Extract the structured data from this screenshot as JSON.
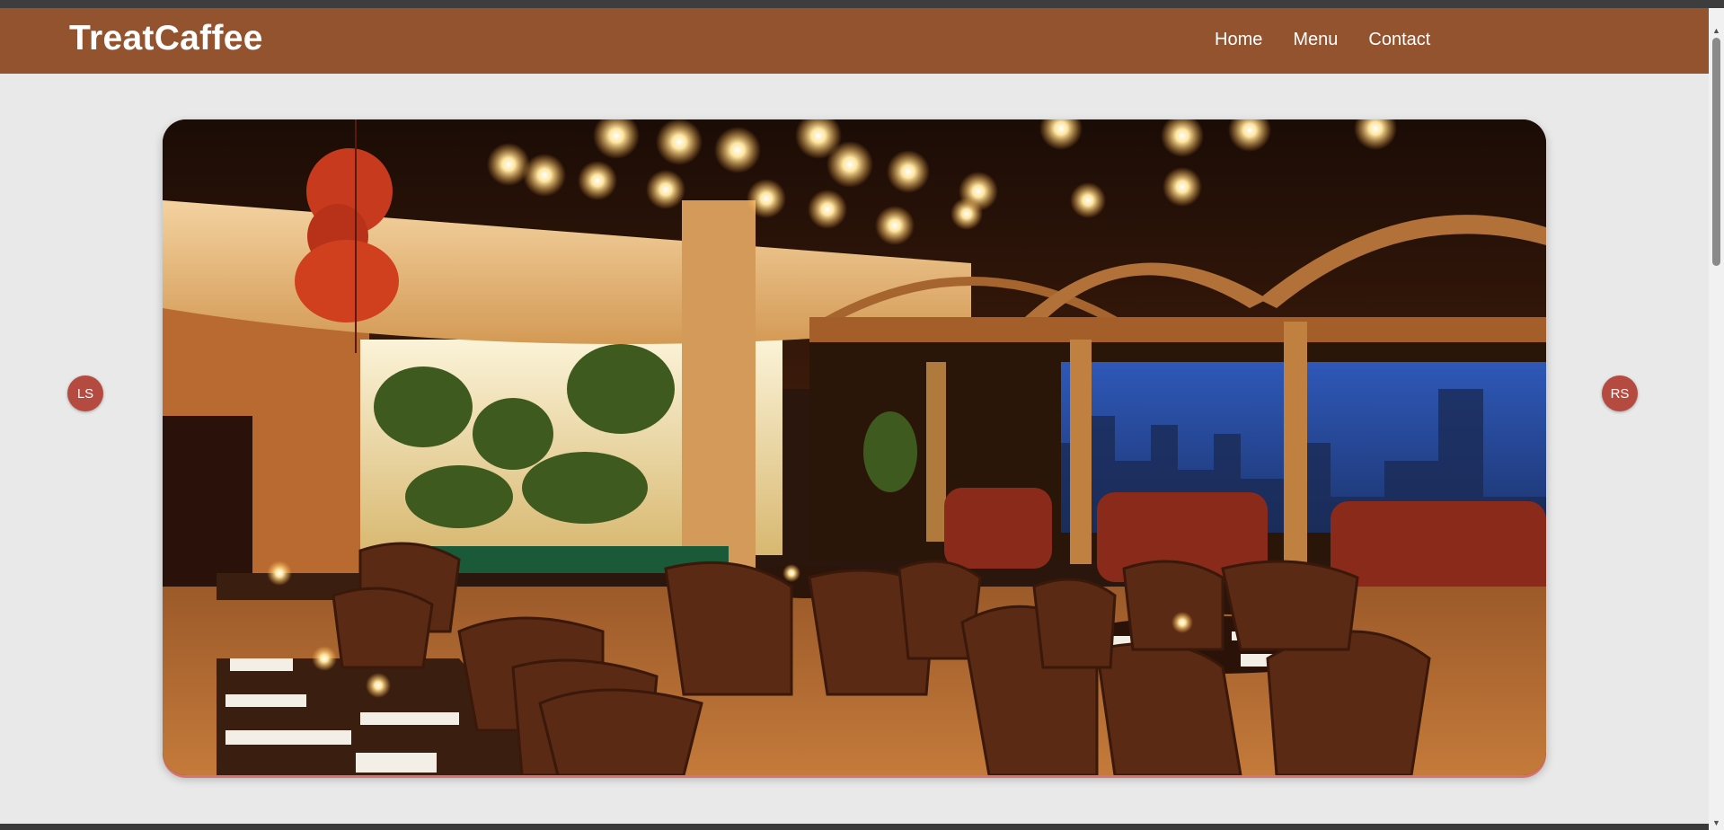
{
  "brand": {
    "name": "TreatCaffee"
  },
  "nav": {
    "items": [
      {
        "label": "Home"
      },
      {
        "label": "Menu"
      },
      {
        "label": "Contact"
      }
    ]
  },
  "slider": {
    "prev_label": "LS",
    "next_label": "RS",
    "image_icon": "restaurant-interior-photo"
  },
  "colors": {
    "navbar": "#94532f",
    "page_background": "#e9e9e9",
    "arrow_button": "#b54a40",
    "slider_border_accent": "#d97272"
  }
}
